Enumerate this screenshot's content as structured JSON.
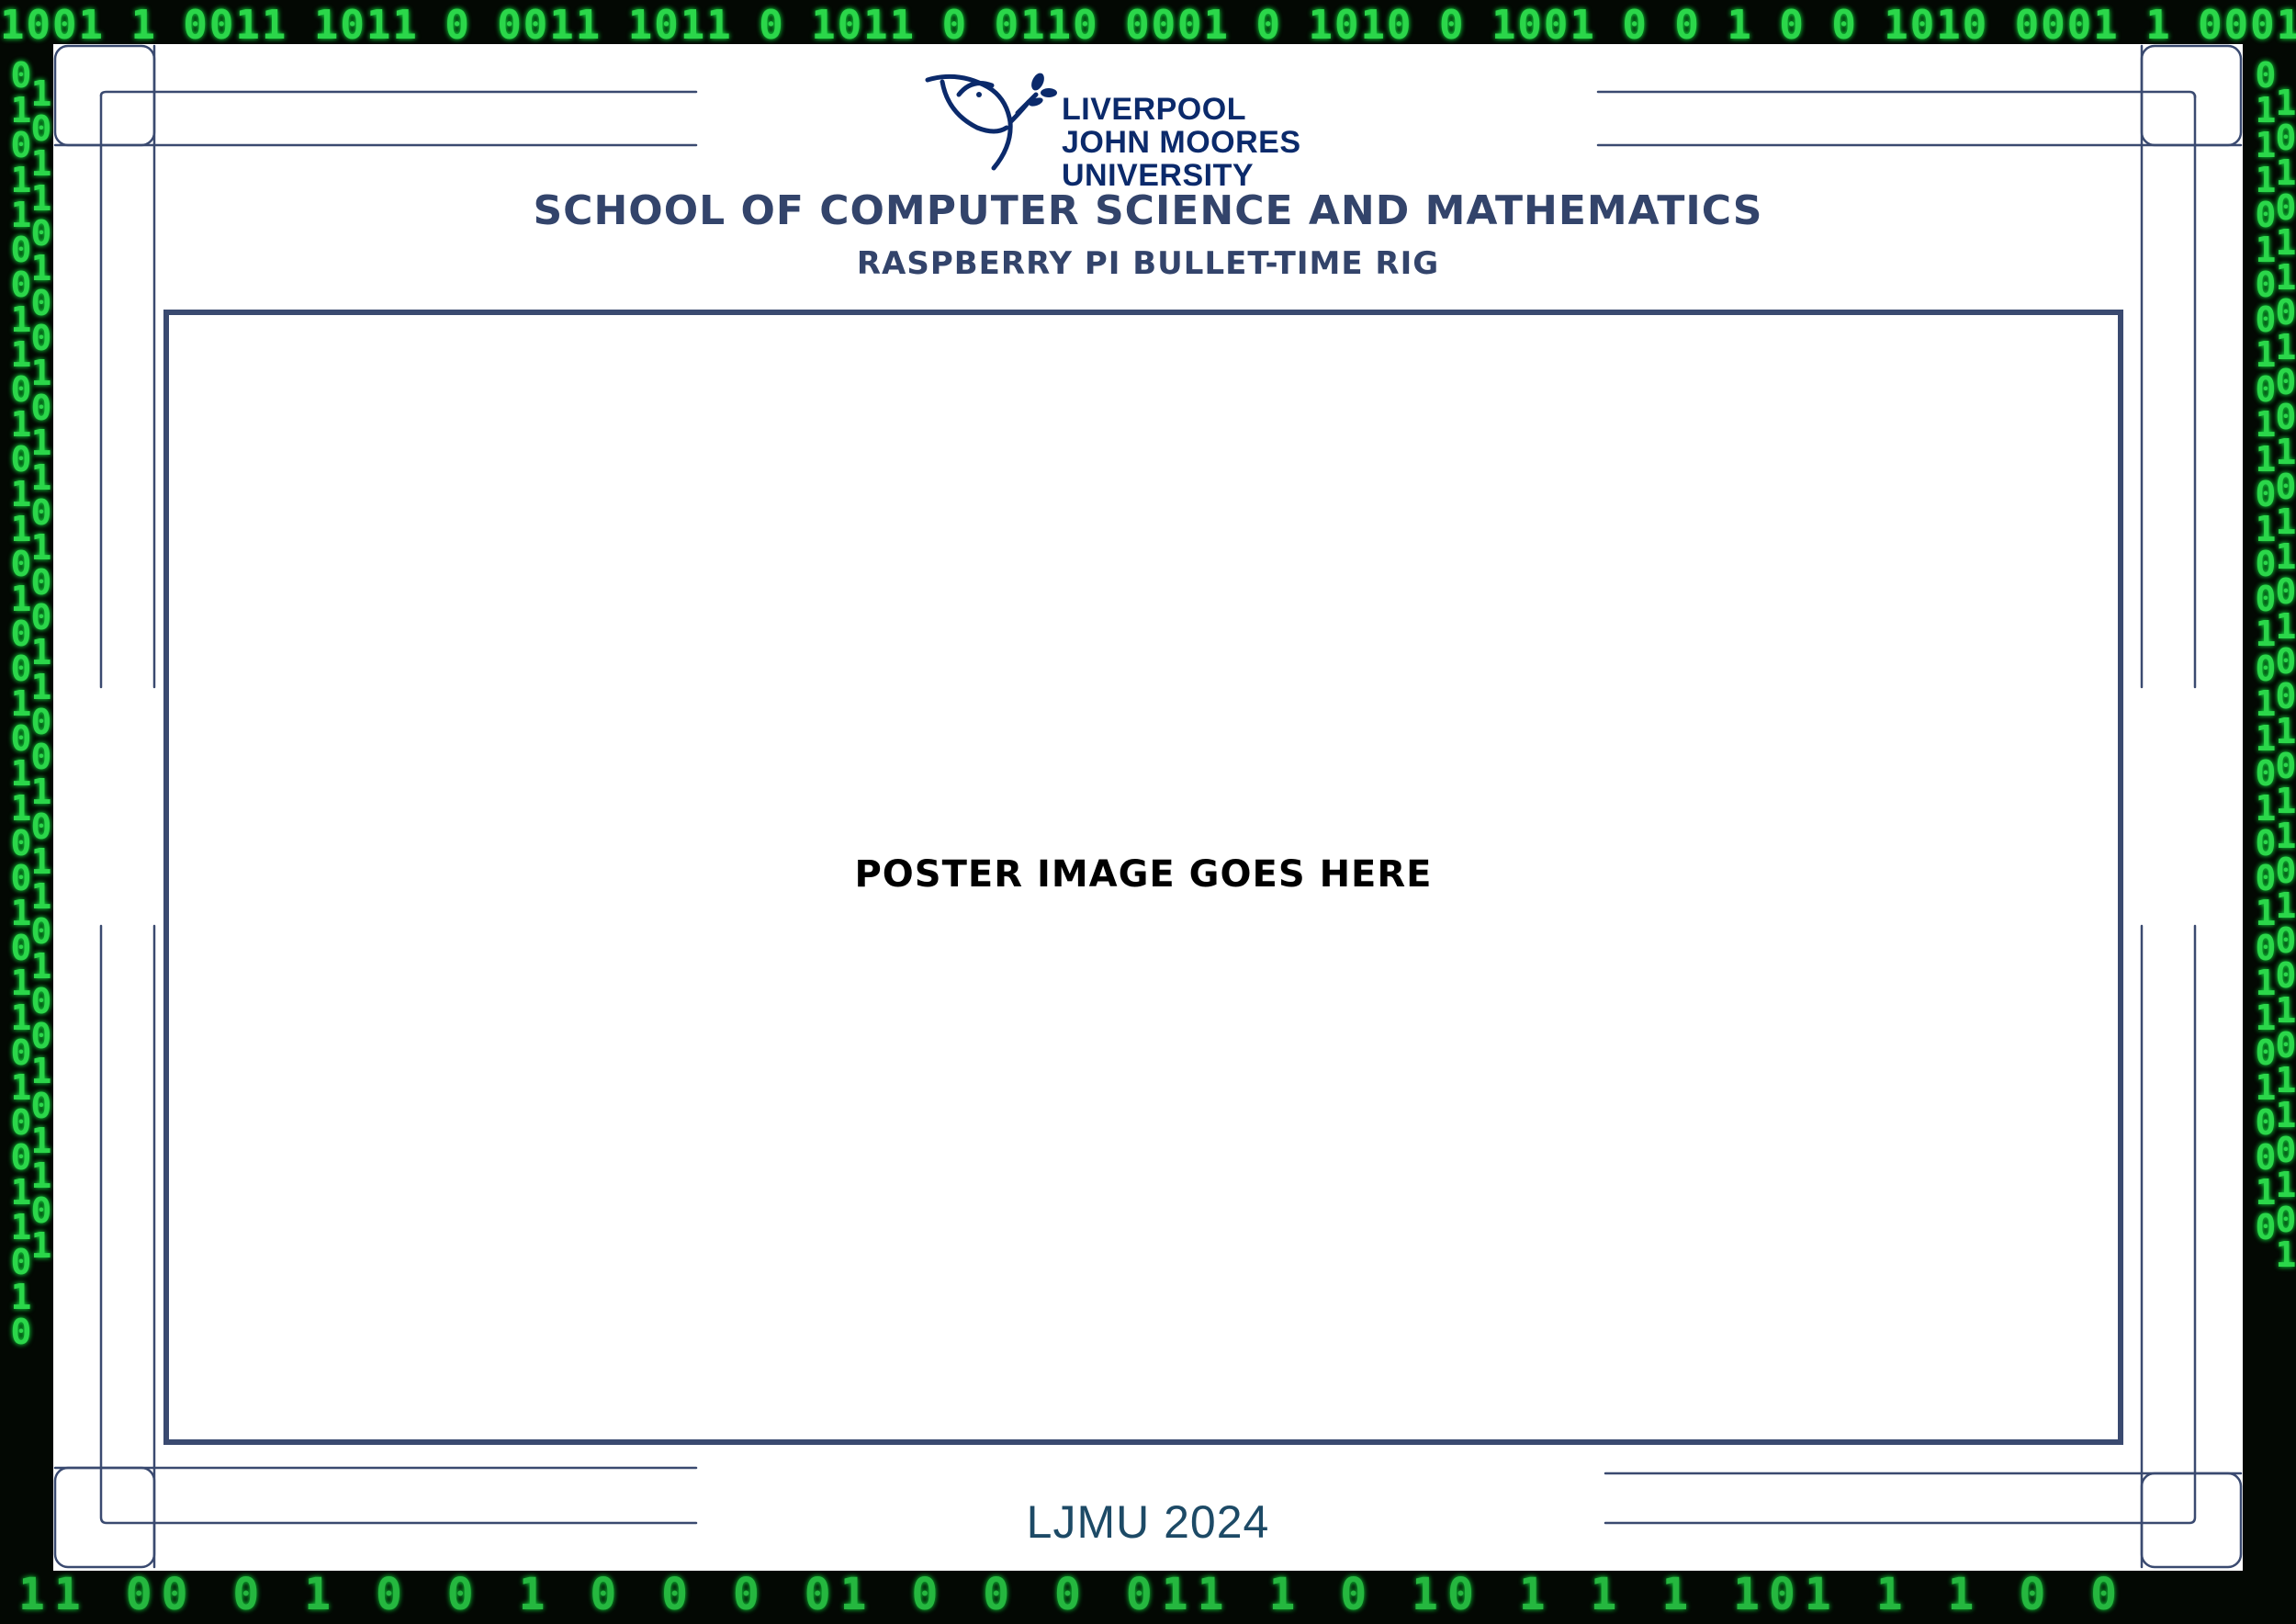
{
  "logo": {
    "icon": "ljmu-liver-bird-logo",
    "line1": "LIVERPOOL",
    "line2": "JOHN MOORES",
    "line3": "UNIVERSITY"
  },
  "header": {
    "school": "School of Computer Science and Mathematics",
    "project": "Raspberry Pi Bullet-Time Rig"
  },
  "main": {
    "placeholder": "Poster image goes here"
  },
  "footer": {
    "text": "LJMU 2024"
  },
  "colors": {
    "navy": "#33446b",
    "frame": "#3a4a70",
    "matrix_green": "#2bd64a"
  }
}
